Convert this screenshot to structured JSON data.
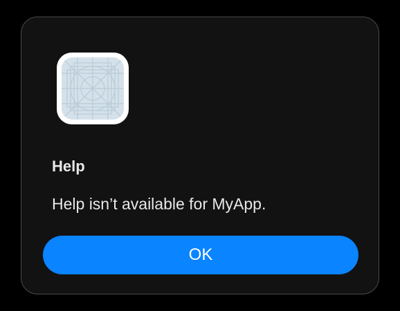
{
  "alert": {
    "app_icon": "app-placeholder-icon",
    "title": "Help",
    "message": "Help isn’t available for MyApp.",
    "ok_label": "OK"
  },
  "colors": {
    "background": "#000000",
    "panel": "#121212",
    "panel_border": "#4a4a4c",
    "accent": "#0a84ff",
    "text": "#e8e8e8",
    "icon_fill": "#d4e1ea",
    "icon_grid": "#b9cbd7"
  }
}
